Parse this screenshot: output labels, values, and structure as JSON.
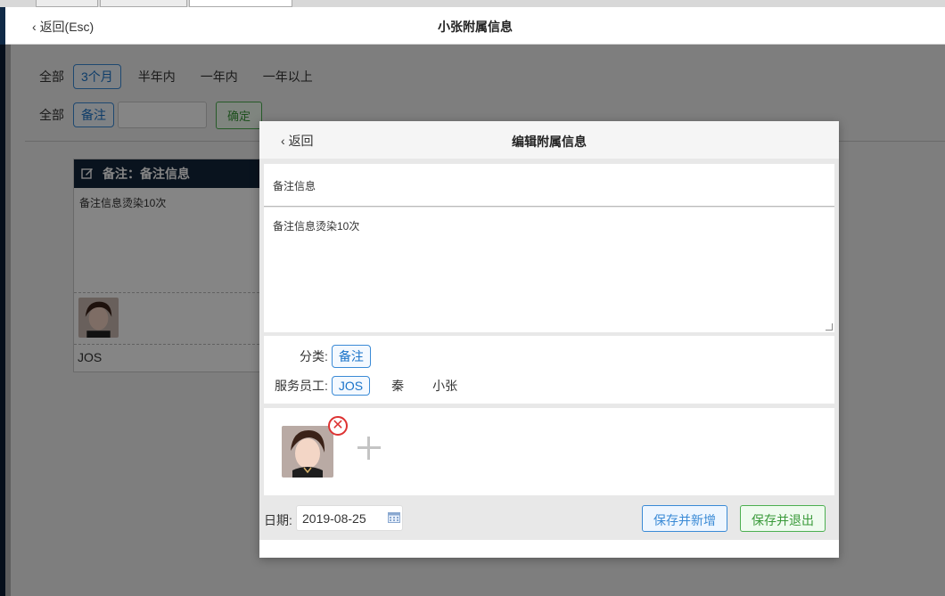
{
  "page": {
    "back_label": "返回(Esc)",
    "title": "小张附属信息"
  },
  "filters": {
    "time_label": "全部",
    "time_options": [
      "3个月",
      "半年内",
      "一年内",
      "一年以上"
    ],
    "time_selected": "3个月",
    "type_label": "全部",
    "type_selected": "备注",
    "search_value": "",
    "confirm_label": "确定"
  },
  "card": {
    "header": "备注：备注信息",
    "text": "备注信息烫染10次",
    "staff": "JOS"
  },
  "modal": {
    "back_label": "返回",
    "title": "编辑附属信息",
    "title_field": "备注信息",
    "content": "备注信息烫染10次",
    "category_label": "分类:",
    "category_value": "备注",
    "staff_label": "服务员工:",
    "staff_options": [
      "JOS",
      "秦",
      "小张"
    ],
    "staff_selected": "JOS",
    "date_label": "日期:",
    "date_value": "2019-08-25",
    "save_new_label": "保存并新增",
    "save_exit_label": "保存并退出"
  },
  "colors": {
    "accent_blue": "#3a8ad6",
    "accent_green": "#4caf50",
    "card_header": "#12253a"
  }
}
